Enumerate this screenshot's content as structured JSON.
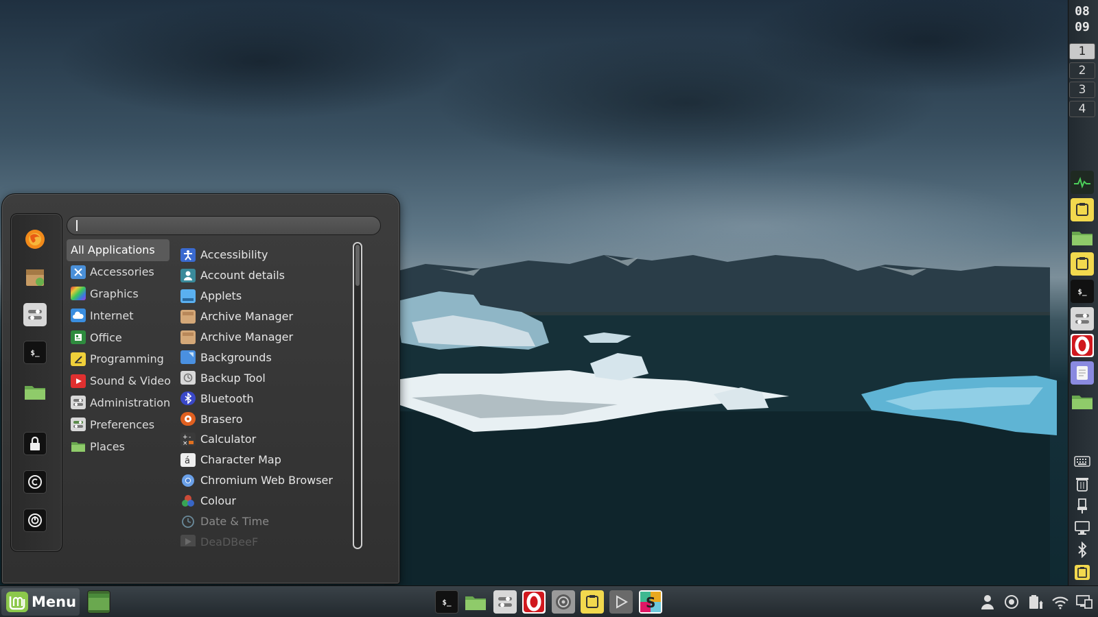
{
  "desktop": {
    "wallpaper": "jokulsarlon-glacier-lagoon"
  },
  "right_panel": {
    "clock": {
      "hour": "08",
      "minute": "09"
    },
    "workspaces": [
      "1",
      "2",
      "3",
      "4"
    ],
    "active_workspace": "1",
    "apps": [
      "system-monitor-icon",
      "sticky-notes-icon",
      "files-icon",
      "sticky-notes-icon",
      "terminal-icon",
      "settings-icon",
      "opera-icon",
      "text-editor-icon",
      "files-icon"
    ],
    "tray": [
      "keyboard-icon",
      "trash-icon",
      "usb-icon",
      "display-icon",
      "bluetooth-icon",
      "sticky-notes-icon"
    ]
  },
  "menu": {
    "search": {
      "value": "",
      "placeholder": ""
    },
    "favorites": [
      "firefox-icon",
      "software-manager-icon",
      "settings-icon",
      "terminal-icon",
      "files-icon",
      "lock-icon",
      "logout-icon",
      "power-icon"
    ],
    "categories": [
      {
        "label": "All Applications",
        "icon": "all-apps"
      },
      {
        "label": "Accessories",
        "icon": "accessories-icon"
      },
      {
        "label": "Graphics",
        "icon": "graphics-icon"
      },
      {
        "label": "Internet",
        "icon": "internet-icon"
      },
      {
        "label": "Office",
        "icon": "office-icon"
      },
      {
        "label": "Programming",
        "icon": "programming-icon"
      },
      {
        "label": "Sound & Video",
        "icon": "sound-video-icon"
      },
      {
        "label": "Administration",
        "icon": "administration-icon"
      },
      {
        "label": "Preferences",
        "icon": "preferences-icon"
      },
      {
        "label": "Places",
        "icon": "places-icon"
      }
    ],
    "active_category": "All Applications",
    "applications": [
      {
        "label": "Accessibility",
        "icon": "accessibility-icon"
      },
      {
        "label": "Account details",
        "icon": "account-icon"
      },
      {
        "label": "Applets",
        "icon": "applets-icon"
      },
      {
        "label": "Archive Manager",
        "icon": "archive-icon"
      },
      {
        "label": "Archive Manager",
        "icon": "archive-icon"
      },
      {
        "label": "Backgrounds",
        "icon": "backgrounds-icon"
      },
      {
        "label": "Backup Tool",
        "icon": "backup-icon"
      },
      {
        "label": "Bluetooth",
        "icon": "bluetooth-icon"
      },
      {
        "label": "Brasero",
        "icon": "brasero-icon"
      },
      {
        "label": "Calculator",
        "icon": "calculator-icon"
      },
      {
        "label": "Character Map",
        "icon": "character-map-icon"
      },
      {
        "label": "Chromium Web Browser",
        "icon": "chromium-icon"
      },
      {
        "label": "Colour",
        "icon": "colour-icon"
      },
      {
        "label": "Date & Time",
        "icon": "clock-icon"
      },
      {
        "label": "DeaDBeeF",
        "icon": "deadbeef-icon"
      }
    ]
  },
  "bottom_panel": {
    "menu_button_label": "Menu",
    "launchers": [
      "terminal-icon",
      "files-icon",
      "settings-icon",
      "opera-icon",
      "audio-icon",
      "sticky-notes-icon",
      "media-player-icon",
      "slack-icon"
    ],
    "tray": [
      "user-icon",
      "record-icon",
      "battery-icon",
      "wifi-icon",
      "display-icon"
    ]
  }
}
